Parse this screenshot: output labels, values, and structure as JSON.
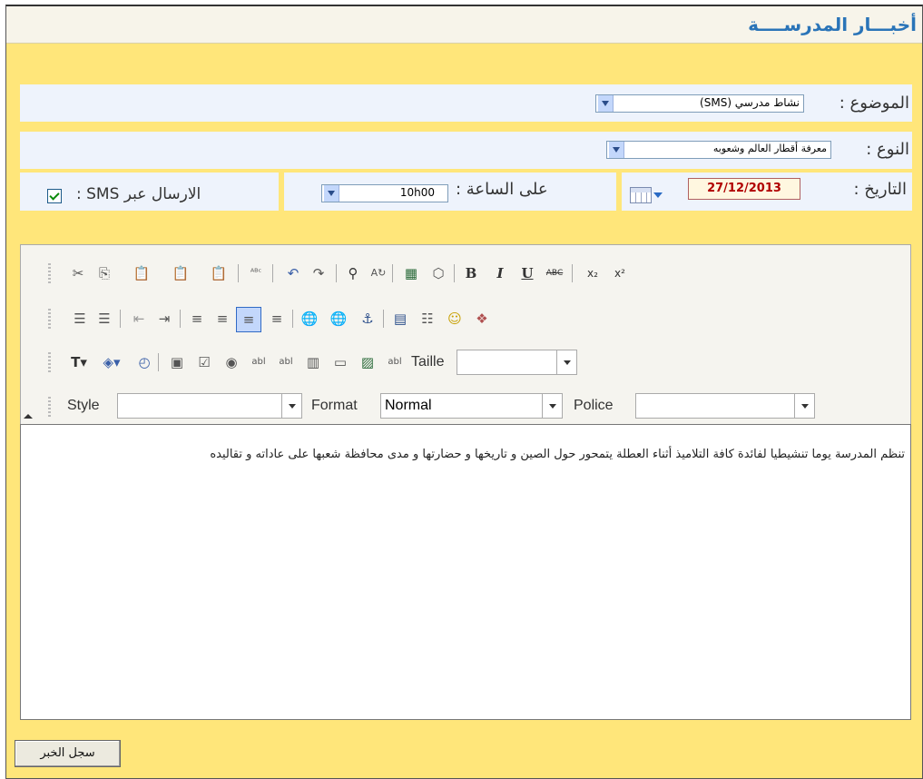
{
  "header": {
    "title": "أخبـــار المدرســــة"
  },
  "form": {
    "subject": {
      "label": "الموضوع :",
      "value": "نشاط مدرسي (SMS)"
    },
    "type": {
      "label": "النوع :",
      "value": "معرفة أقطار العالم وشعوبه"
    },
    "date": {
      "label": "التاريخ :",
      "value": "27/12/2013"
    },
    "time": {
      "label": "على الساعة :",
      "value": "10h00"
    },
    "sms": {
      "label": "الارسال عبر SMS :",
      "checked": true
    }
  },
  "editor": {
    "toolbar_row1": [
      "cut-icon",
      "copy-icon",
      "paste-icon",
      "paste-text-icon",
      "paste-word-icon",
      "spellcheck-icon",
      "undo-icon",
      "redo-icon",
      "find-icon",
      "replace-icon",
      "select-all-icon",
      "eraser-icon",
      "bold-icon",
      "italic-icon",
      "underline-icon",
      "strikethrough-icon",
      "subscript-icon",
      "superscript-icon"
    ],
    "toolbar_row1_glyphs": {
      "bold": "B",
      "italic": "I",
      "underline": "U",
      "strike": "ABC",
      "sub": "x₂",
      "sup": "x²"
    },
    "taille_label": "Taille",
    "style_label": "Style",
    "format_label": "Format",
    "format_value": "Normal",
    "police_label": "Police",
    "content": "تنظم المدرسة يوما تنشيطيا لفائدة كافة التلاميذ أثناء العطلة يتمحور حول الصين و تاريخها و حضارتها و مدى محافظة شعبها على عاداته و تقاليده"
  },
  "save_button": "سجل الخبر"
}
